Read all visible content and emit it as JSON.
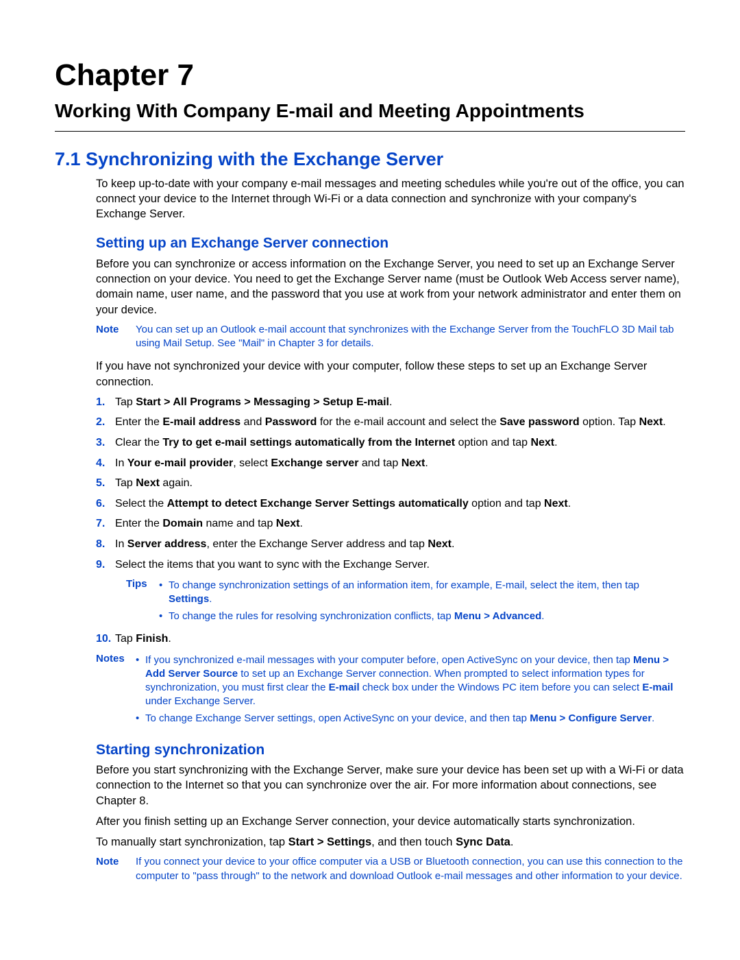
{
  "chapter": {
    "title": "Chapter 7",
    "subtitle": "Working With Company E-mail and Meeting Appointments"
  },
  "sec71": {
    "heading": "7.1  Synchronizing with the Exchange Server",
    "intro": "To keep up-to-date with your company e-mail messages and meeting schedules while you're out of the office, you can connect your device to the Internet through Wi-Fi or a data connection and synchronize with your company's Exchange Server."
  },
  "setup": {
    "heading": "Setting up an Exchange Server connection",
    "p1": "Before you can synchronize or access information on the Exchange Server, you need to set up an Exchange Server connection on your device. You need to get the Exchange Server name (must be Outlook Web Access server name), domain name, user name, and the password that you use at work from your network administrator and enter them on your device.",
    "note1_label": "Note",
    "note1": "You can set up an Outlook e-mail account that synchronizes with the Exchange Server from the TouchFLO 3D Mail tab using Mail Setup. See \"Mail\" in Chapter 3 for details.",
    "p2": "If you have not synchronized your device with your computer, follow these steps to set up an Exchange Server connection.",
    "steps": {
      "s1a": "Tap ",
      "s1b": "Start > All Programs > Messaging > Setup E-mail",
      "s1c": ".",
      "s2a": "Enter the ",
      "s2b": "E-mail address",
      "s2c": " and ",
      "s2d": "Password",
      "s2e": " for the e-mail account and select the ",
      "s2f": "Save password",
      "s2g": " option. Tap ",
      "s2h": "Next",
      "s2i": ".",
      "s3a": "Clear the ",
      "s3b": "Try to get e-mail settings automatically from the Internet",
      "s3c": " option and tap ",
      "s3d": "Next",
      "s3e": ".",
      "s4a": "In ",
      "s4b": "Your e-mail provider",
      "s4c": ", select ",
      "s4d": "Exchange server",
      "s4e": " and tap ",
      "s4f": "Next",
      "s4g": ".",
      "s5a": "Tap ",
      "s5b": "Next",
      "s5c": " again.",
      "s6a": "Select the ",
      "s6b": "Attempt to detect Exchange Server Settings automatically",
      "s6c": " option and tap ",
      "s6d": "Next",
      "s6e": ".",
      "s7a": "Enter the ",
      "s7b": "Domain",
      "s7c": " name and tap ",
      "s7d": "Next",
      "s7e": ".",
      "s8a": "In ",
      "s8b": "Server address",
      "s8c": ", enter the Exchange Server address and tap ",
      "s8d": "Next",
      "s8e": ".",
      "s9": "Select the items that you want to sync with the Exchange Server."
    },
    "tips_label": "Tips",
    "tip1a": "To change synchronization settings of an information item, for example, E-mail, select the item, then tap ",
    "tip1b": "Settings",
    "tip1c": ".",
    "tip2a": "To change the rules for resolving synchronization conflicts, tap ",
    "tip2b": "Menu > Advanced",
    "tip2c": ".",
    "s10num": "10.",
    "s10a": "Tap ",
    "s10b": "Finish",
    "s10c": ".",
    "notes_label": "Notes",
    "n1a": "If you synchronized e-mail messages with your computer before, open ActiveSync on your device, then tap ",
    "n1b": "Menu > Add Server Source",
    "n1c": " to set up an Exchange Server connection. When prompted to select information types for synchronization, you must first clear the ",
    "n1d": "E-mail",
    "n1e": " check box under the Windows PC item before you can select ",
    "n1f": "E-mail",
    "n1g": " under Exchange Server.",
    "n2a": "To change Exchange Server settings, open ActiveSync on your device, and then tap ",
    "n2b": "Menu > Configure Server",
    "n2c": "."
  },
  "start": {
    "heading": "Starting synchronization",
    "p1": "Before you start synchronizing with the Exchange Server, make sure your device has been set up with a Wi-Fi or data connection to the Internet so that you can synchronize over the air. For more information about connections, see Chapter 8.",
    "p2": "After you finish setting up an Exchange Server connection, your device automatically starts synchronization.",
    "p3a": "To manually start synchronization, tap ",
    "p3b": "Start > Settings",
    "p3c": ", and then touch ",
    "p3d": "Sync Data",
    "p3e": ".",
    "note_label": "Note",
    "note": "If you connect your device to your office computer via a USB or Bluetooth connection, you can use this connection to the computer to \"pass through\" to the network and download Outlook e-mail messages and other information to your device."
  }
}
